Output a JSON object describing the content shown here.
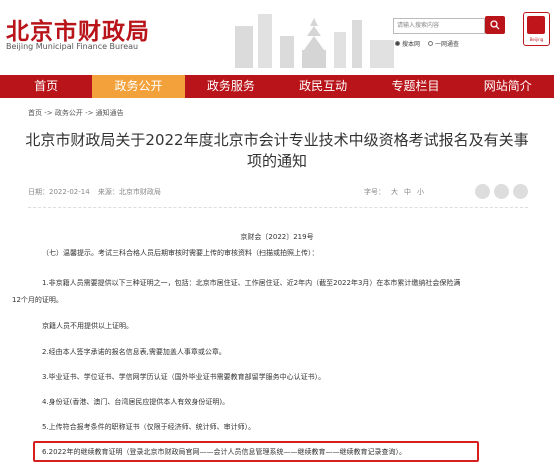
{
  "header": {
    "logo_cn": "北京市财政局",
    "logo_en": "Beijing Municipal Finance Bureau",
    "search_placeholder": "请输入搜索内容",
    "radio_1": "搜本网",
    "radio_2": "一网通查"
  },
  "nav": {
    "items": [
      "首页",
      "政务公开",
      "政务服务",
      "政民互动",
      "专题栏目",
      "网站简介"
    ],
    "active_index": 1
  },
  "breadcrumb": "首页 -> 政务公开 -> 通知通告",
  "article": {
    "title": "北京市财政局关于2022年度北京市会计专业技术中级资格考试报名及有关事项的通知",
    "date": "日期：2022-02-14",
    "source": "来源：北京市财政局",
    "fontsize_label": "字号：",
    "fontsize_large": "大",
    "fontsize_medium": "中",
    "fontsize_small": "小",
    "doc_no": "京财会〔2022〕219号",
    "p0": "（七）温馨提示。考试三科合格人员后期审核时需要上传的审核资料（扫描或拍照上传）：",
    "p1a": "1.非京籍人员需要提供以下三种证明之一，包括：北京市居住证、工作居住证、近2年内（截至2022年3月）在本市累计缴纳社会保险满",
    "p1b": "12个月的证明。",
    "p2": "京籍人员不用提供以上证明。",
    "p3": "2.经由本人签字承诺的报名信息表,需要加盖人事章或公章。",
    "p4": "3.毕业证书、学位证书、学信网学历认证（国外毕业证书需要教育部留学服务中心认证书）。",
    "p5": "4.身份证(香港、澳门、台湾居民应提供本人有效身份证明)。",
    "p6": "5.上传符合报考条件的职称证书（仅限于经济师、统计师、审计师）。",
    "p7": "6.2022年的继续教育证明（登录北京市财政局官网——会计人员信息管理系统——继续教育——继续教育记录查询）。"
  },
  "colors": {
    "brand_red": "#b8141a",
    "active_tab": "#f2a13b",
    "highlight_border": "#d6201f"
  }
}
